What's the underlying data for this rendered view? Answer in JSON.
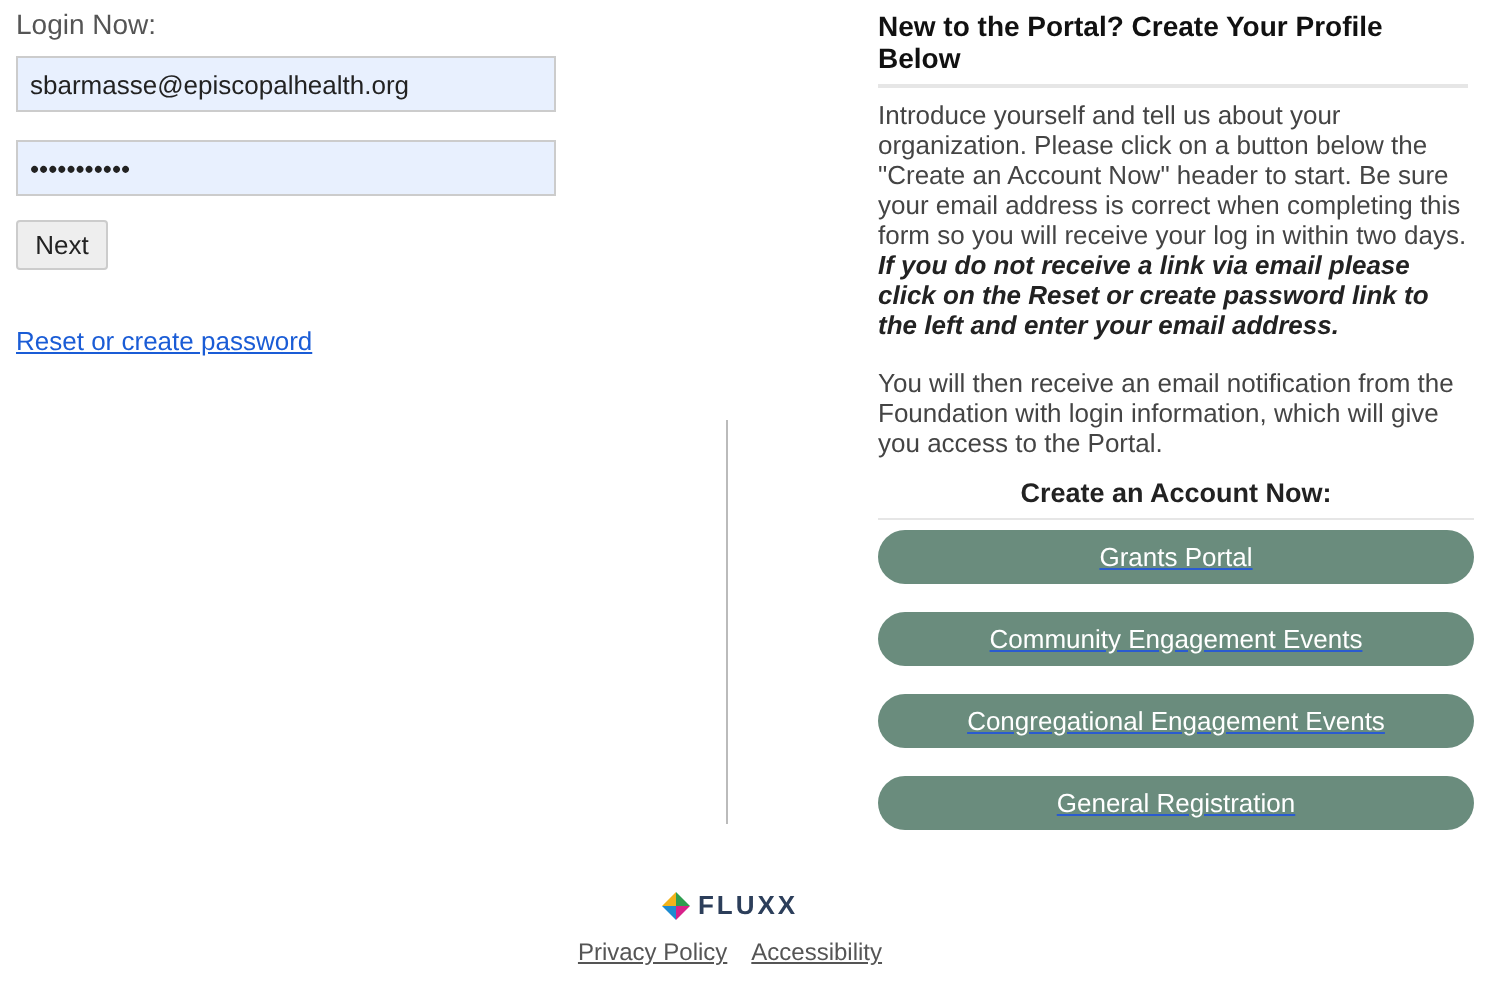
{
  "login": {
    "title": "Login Now:",
    "email": {
      "value": "sbarmasse@episcopalhealth.org"
    },
    "password": {
      "value": "•••••••••••"
    },
    "next_button": "Next",
    "reset_link": "Reset or create password"
  },
  "signup": {
    "title": "New to the Portal? Create Your Profile Below",
    "paragraphs": [
      "Introduce yourself and tell us about your organization. Please click on a button below the \"Create an Account Now\" header to start.  Be sure your email address is correct when completing this form so you will receive your log in within two days. *If you do not receive a link via email please click on the Reset or create password link to the left and enter your email address.*",
      "You will then receive an email notification from the Foundation with login information, which will give you access to the Portal."
    ],
    "accounts_heading": "Create an Account Now:",
    "buttons": [
      "Grants Portal",
      "Community Engagement Events",
      "Congregational Engagement Events",
      "General Registration"
    ]
  },
  "footer": {
    "brand": "FLUXX",
    "links": [
      "Privacy Policy",
      "Accessibility"
    ]
  }
}
